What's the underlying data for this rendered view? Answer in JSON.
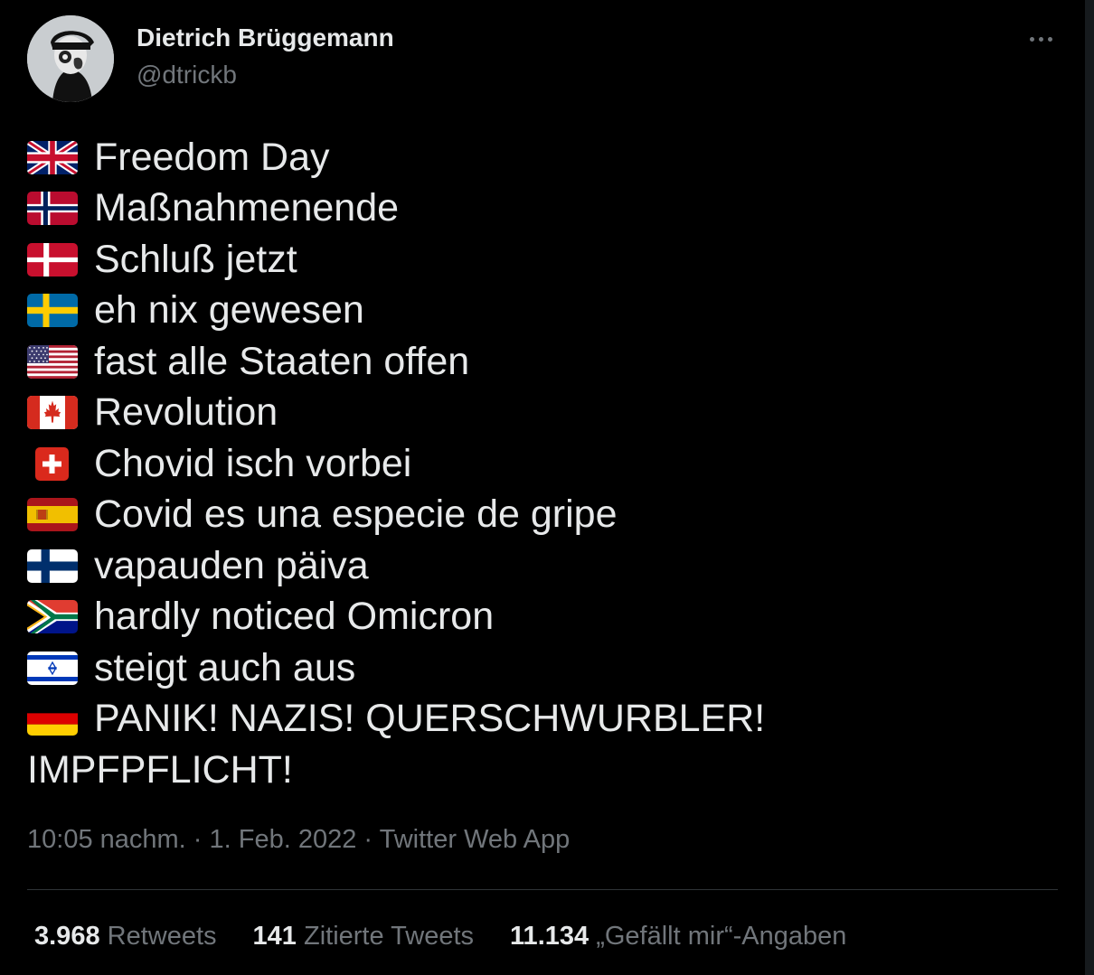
{
  "author": {
    "name": "Dietrich Brüggemann",
    "handle": "@dtrickb"
  },
  "tweet": {
    "lines": [
      {
        "flag": "uk-flag-icon",
        "text": "Freedom Day"
      },
      {
        "flag": "norway-flag-icon",
        "text": "Maßnahmenende"
      },
      {
        "flag": "denmark-flag-icon",
        "text": "Schluß jetzt"
      },
      {
        "flag": "sweden-flag-icon",
        "text": "eh nix gewesen"
      },
      {
        "flag": "usa-flag-icon",
        "text": "fast alle Staaten offen"
      },
      {
        "flag": "canada-flag-icon",
        "text": "Revolution"
      },
      {
        "flag": "switzerland-flag-icon",
        "text": "Chovid isch vorbei"
      },
      {
        "flag": "spain-flag-icon",
        "text": "Covid es una especie de gripe"
      },
      {
        "flag": "finland-flag-icon",
        "text": "vapauden päiva"
      },
      {
        "flag": "south-africa-flag-icon",
        "text": "hardly noticed Omicron"
      },
      {
        "flag": "israel-flag-icon",
        "text": "steigt auch aus"
      },
      {
        "flag": "germany-flag-icon",
        "text": "PANIK! NAZIS! QUERSCHWURBLER!"
      }
    ],
    "continuation": "IMPFPFLICHT!"
  },
  "meta": {
    "time": "10:05 nachm.",
    "sep1": " · ",
    "date": "1. Feb. 2022",
    "sep2": " · ",
    "source": "Twitter Web App"
  },
  "stats": {
    "retweets_count": "3.968",
    "retweets_label": "Retweets",
    "quotes_count": "141",
    "quotes_label": "Zitierte Tweets",
    "likes_count": "11.134",
    "likes_label": "„Gefällt mir“-Angaben"
  },
  "colors": {
    "background": "#000000",
    "text_primary": "#e7e9ea",
    "text_secondary": "#71767b",
    "divider": "#2f3336"
  }
}
